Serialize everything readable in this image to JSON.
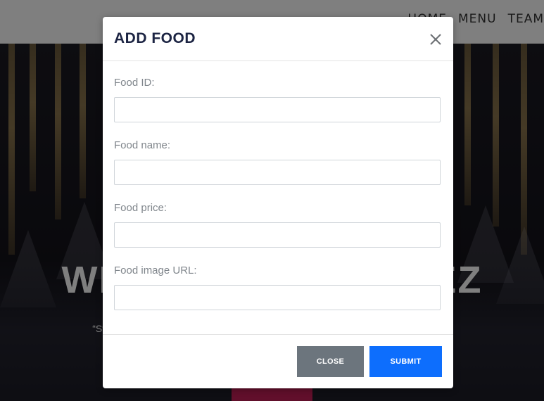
{
  "nav": {
    "items": [
      "HOME",
      "MENU",
      "TEAM"
    ]
  },
  "hero": {
    "title": "WELCOME TO LOPEZ",
    "subtitle": "“Stop by and enjoy the taste of our freshly prepared food made with love and care”"
  },
  "modal": {
    "title": "ADD FOOD",
    "close_icon": "close-x-icon",
    "fields": [
      {
        "label": "Food ID:",
        "value": "",
        "placeholder": ""
      },
      {
        "label": "Food name:",
        "value": "",
        "placeholder": ""
      },
      {
        "label": "Food price:",
        "value": "",
        "placeholder": ""
      },
      {
        "label": "Food image URL:",
        "value": "",
        "placeholder": ""
      }
    ],
    "buttons": {
      "close": "CLOSE",
      "submit": "SUBMIT"
    }
  },
  "colors": {
    "title": "#1c2443",
    "close_button": "#6c757d",
    "submit_button": "#0d6efd",
    "hero_button": "#c21e57"
  }
}
